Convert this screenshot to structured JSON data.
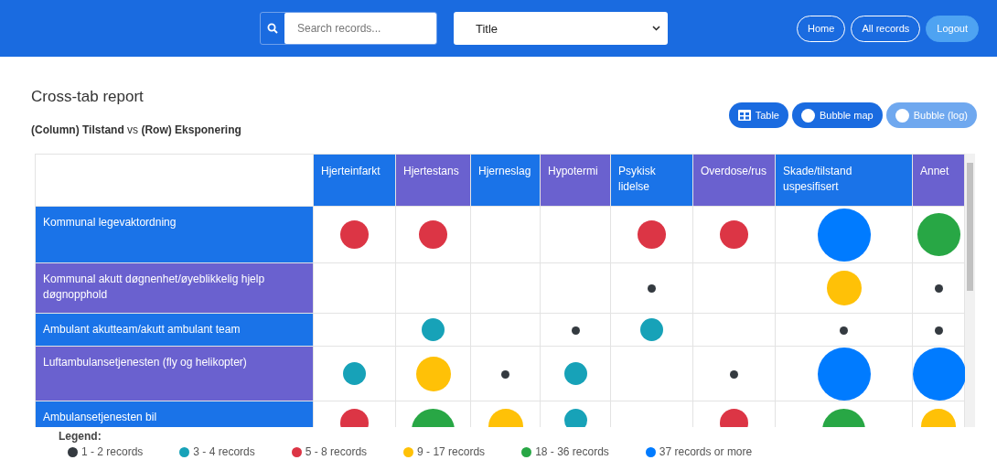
{
  "header": {
    "search": {
      "placeholder": "Search records..."
    },
    "field_select": {
      "value": "Title"
    },
    "nav": [
      {
        "label": "Home",
        "kind": "outline"
      },
      {
        "label": "All records",
        "kind": "outline"
      },
      {
        "label": "Logout",
        "kind": "filled"
      }
    ]
  },
  "report": {
    "title": "Cross-tab report",
    "subtitle": "**(Column) Tilstand** vs **(Row) Eksponering**",
    "views": [
      {
        "label": "Table",
        "kind": "table",
        "selected": false
      },
      {
        "label": "Bubble map",
        "kind": "bubble",
        "selected": false
      },
      {
        "label": "Bubble (log)",
        "kind": "bubble",
        "selected": true
      }
    ],
    "columns": [
      "Hjerteinfarkt",
      "Hjertestans",
      "Hjerneslag",
      "Hypotermi",
      "Psykisk lidelse",
      "Overdose/rus",
      "Skade/tilstand uspesifisert",
      "Annet"
    ],
    "rows": [
      {
        "label": "Kommunal legevaktordning",
        "cells": [
          {
            "color": "#dc3545"
          },
          {
            "color": "#dc3545"
          },
          null,
          null,
          {
            "color": "#dc3545"
          },
          {
            "color": "#dc3545"
          },
          {
            "color": "#007bff"
          },
          {
            "color": "#28a745"
          }
        ]
      },
      {
        "label": "Kommunal akutt døgnenhet/øyeblikkelig hjelp døgnopphold",
        "cells": [
          null,
          null,
          null,
          null,
          {
            "color": "#343a40"
          },
          null,
          {
            "color": "#ffc107"
          },
          {
            "color": "#343a40"
          }
        ]
      },
      {
        "label": "Ambulant akutteam/akutt ambulant team",
        "cells": [
          null,
          {
            "color": "#17a2b8"
          },
          null,
          {
            "color": "#343a40"
          },
          {
            "color": "#17a2b8"
          },
          null,
          {
            "color": "#343a40"
          },
          {
            "color": "#343a40"
          }
        ]
      },
      {
        "label": "Luftambulansetjenesten (fly og helikopter)",
        "cells": [
          {
            "color": "#17a2b8"
          },
          {
            "color": "#ffc107"
          },
          {
            "color": "#343a40"
          },
          {
            "color": "#17a2b8"
          },
          null,
          {
            "color": "#343a40"
          },
          {
            "color": "#007bff"
          },
          {
            "color": "#007bff"
          }
        ]
      },
      {
        "label": "Ambulansetjenesten bil",
        "cells": [
          {
            "color": "#dc3545"
          },
          {
            "color": "#28a745"
          },
          {
            "color": "#ffc107"
          },
          {
            "color": "#17a2b8"
          },
          null,
          {
            "color": "#dc3545"
          },
          {
            "color": "#28a745"
          },
          {
            "color": "#ffc107"
          }
        ]
      }
    ],
    "legend": {
      "title": "Legend:",
      "items": [
        {
          "label": "1 - 2 records",
          "color": "#343a40"
        },
        {
          "label": "3 - 4 records",
          "color": "#17a2b8"
        },
        {
          "label": "5 - 8 records",
          "color": "#dc3545"
        },
        {
          "label": "9 - 17 records",
          "color": "#ffc107"
        },
        {
          "label": "18 - 36 records",
          "color": "#28a745"
        },
        {
          "label": "37 records or more",
          "color": "#007bff"
        }
      ]
    }
  }
}
